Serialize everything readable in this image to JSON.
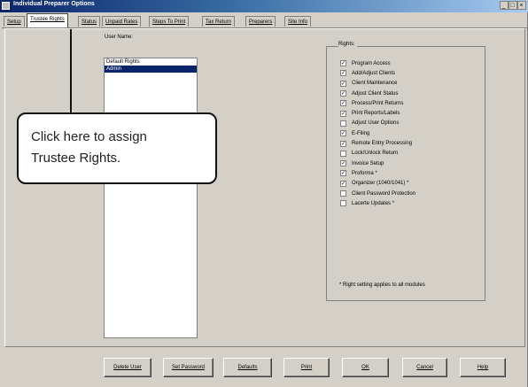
{
  "window": {
    "title": "Individual Preparer Options",
    "controls": [
      "_",
      "□",
      "×"
    ]
  },
  "tabs": [
    {
      "label": "Setup"
    },
    {
      "label": "Trustee Rights",
      "active": true
    },
    {
      "label": "Status"
    },
    {
      "label": "Unpaid Rates"
    },
    {
      "label": "Steps To Print"
    },
    {
      "label": "Tax Return"
    },
    {
      "label": "Preparers"
    },
    {
      "label": "Site Info"
    }
  ],
  "users": {
    "label": "User Name:",
    "items": [
      {
        "name": "Default Rights",
        "selected": false
      },
      {
        "name": "Admin",
        "selected": true
      }
    ]
  },
  "rights": {
    "label": "Rights:",
    "items": [
      {
        "label": "Program Access",
        "checked": true
      },
      {
        "label": "Add/Adjust Clients",
        "checked": true
      },
      {
        "label": "Client Maintenance",
        "checked": true
      },
      {
        "label": "Adjust Client Status",
        "checked": true
      },
      {
        "label": "Process/Print Returns",
        "checked": true
      },
      {
        "label": "Print Reports/Labels",
        "checked": true
      },
      {
        "label": "Adjust User Options",
        "checked": false
      },
      {
        "label": "E-Filing",
        "checked": true
      },
      {
        "label": "Remote Entry Processing",
        "checked": true
      },
      {
        "label": "Lock/Unlock Return",
        "checked": false
      },
      {
        "label": "Invoice Setup",
        "checked": true
      },
      {
        "label": "Proforma *",
        "checked": true
      },
      {
        "label": "Organizer (1040/1041) *",
        "checked": true
      },
      {
        "label": "Client Password Protection",
        "checked": false
      },
      {
        "label": "Lacerte Updates *",
        "checked": false
      }
    ],
    "note": "* Right setting applies to all modules"
  },
  "buttons": {
    "delete_user": "Delete User",
    "set_password": "Set Password",
    "defaults": "Defaults",
    "print": "Print",
    "ok": "OK",
    "cancel": "Cancel",
    "help": "Help"
  },
  "callout": {
    "line1": "Click here to assign",
    "line2": "Trustee Rights."
  },
  "colors": {
    "dialog_bg": "#d4d0c8",
    "title_gradient_start": "#0a246a",
    "selection": "#0a246a"
  }
}
